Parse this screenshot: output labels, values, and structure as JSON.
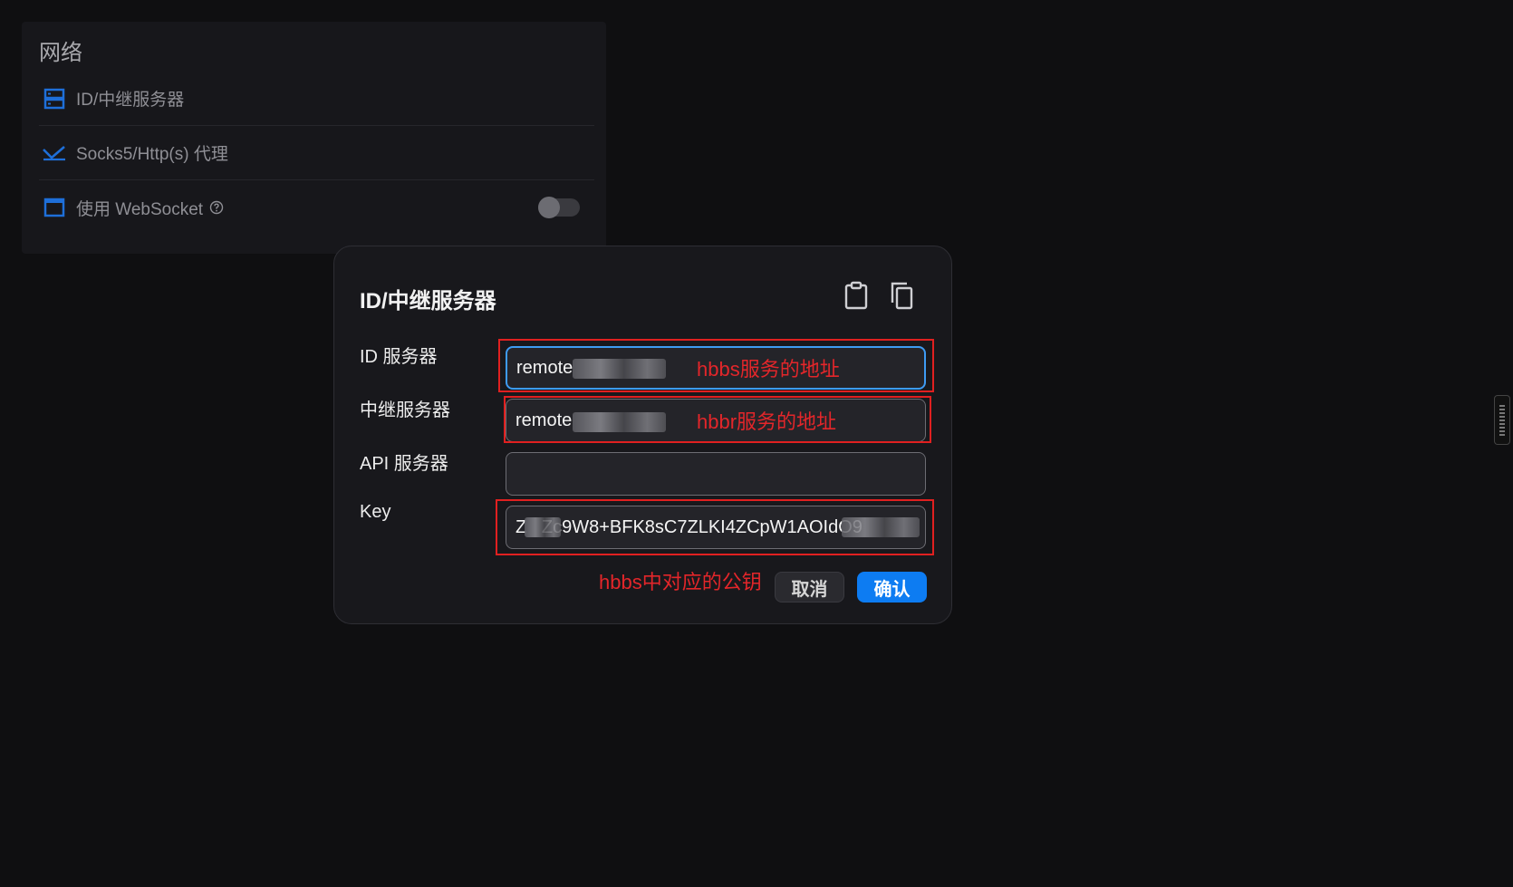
{
  "settings_panel": {
    "title": "网络",
    "items": [
      {
        "label": "ID/中继服务器",
        "icon": "server-icon"
      },
      {
        "label": "Socks5/Http(s) 代理",
        "icon": "proxy-arrow-icon"
      },
      {
        "label": "使用 WebSocket",
        "icon": "window-icon",
        "has_help": true,
        "toggle_on": false
      }
    ]
  },
  "dialog": {
    "title": "ID/中继服务器",
    "paste_icon": "clipboard-icon",
    "copy_icon": "copy-icon",
    "fields": [
      {
        "label": "ID 服务器",
        "value": "remote"
      },
      {
        "label": "中继服务器",
        "value": "remote"
      },
      {
        "label": "API 服务器",
        "value": ""
      },
      {
        "label": "Key",
        "value": "Z   Zc9W8+BFK8sC7ZLKI4ZCpW1AOIdO9"
      }
    ],
    "cancel_label": "取消",
    "confirm_label": "确认"
  },
  "annotations": {
    "id_server": "hbbs服务的地址",
    "relay_server": "hbbr服务的地址",
    "key": "hbbs中对应的公钥"
  },
  "colors": {
    "accent": "#0d7cf2",
    "focus_border": "#3e9bf3",
    "annotation_red": "#e3262a",
    "icon_blue": "#1e6fd9"
  }
}
